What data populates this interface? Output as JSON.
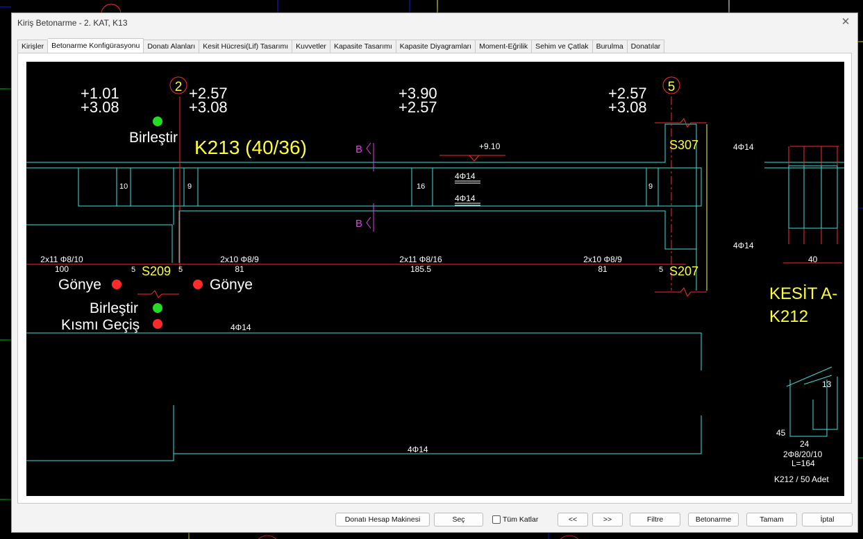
{
  "window": {
    "title": "Kiriş Betonarme - 2. KAT, K13"
  },
  "tabs": [
    "Kirişler",
    "Betonarme Konfigürasyonu",
    "Donatı Alanları",
    "Kesit Hücresi(Lif) Tasarımı",
    "Kuvvetler",
    "Kapasite Tasarımı",
    "Kapasite Diyagramları",
    "Moment-Eğrilik",
    "Sehim ve Çatlak",
    "Burulma",
    "Donatılar"
  ],
  "active_tab": 1,
  "drawing": {
    "axis_left": "2",
    "axis_right": "5",
    "elev_1": [
      "+1.01",
      "+3.08"
    ],
    "elev_2": [
      "+2.57",
      "+3.08"
    ],
    "elev_3": [
      "+3.90",
      "+2.57"
    ],
    "elev_4": [
      "+2.57",
      "+3.08"
    ],
    "beam_label": "K213 (40/36)",
    "section_mark": "B",
    "level_mark": "+9.10",
    "col_top_right": "S307",
    "col_bottom_left": "S209",
    "col_bottom_right": "S207",
    "rebar_top": "4Φ14",
    "rebar_bottom": "4Φ14",
    "rebar_long_top": "4Φ14",
    "rebar_long_bottom": "4Φ14",
    "stirrup_widths": [
      "10",
      "9",
      "16",
      "9"
    ],
    "stirrup_groups": [
      {
        "spec": "2x11 Φ8/10",
        "len": "100"
      },
      {
        "spec": "2x10 Φ8/9",
        "len": "81"
      },
      {
        "spec": "2x11 Φ8/16",
        "len": "185.5"
      },
      {
        "spec": "2x10 Φ8/9",
        "len": "81"
      }
    ],
    "gap_dims": [
      "5",
      "5",
      "5"
    ],
    "markers": {
      "birlestir_top": "Birleştir",
      "gonye_left": "Gönye",
      "gonye_right": "Gönye",
      "birlestir_mid": "Birleştir",
      "kismi_gecis": "Kısmı Geçiş"
    },
    "section": {
      "top_rebar": "4Φ14",
      "bottom_rebar": "4Φ14",
      "width": "40",
      "title": "KESİT A-",
      "beam": "K212"
    },
    "stirrup_detail": {
      "dim_hook": "13",
      "dim_h": "45",
      "dim_w": "24",
      "spec": "2Φ8/20/10",
      "length": "L=164",
      "count": "K212 / 50 Adet"
    },
    "colors": {
      "line": "#3ee0e0",
      "red": "#ff2a2a",
      "yellow": "#ffff33",
      "white": "#ffffff",
      "magenta": "#e040e0",
      "green": "#22dd22"
    }
  },
  "buttons": {
    "calc": "Donatı Hesap Makinesi",
    "select": "Seç",
    "all_floors": "Tüm Katlar",
    "prev": "<<",
    "next": ">>",
    "filter": "Filtre",
    "concrete": "Betonarme",
    "ok": "Tamam",
    "cancel": "İptal"
  }
}
